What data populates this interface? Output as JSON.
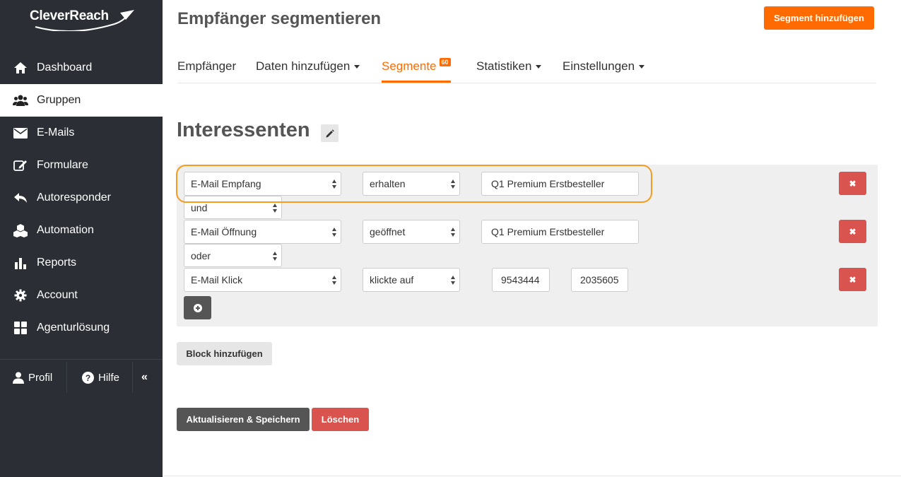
{
  "app": {
    "logo_text": "CleverReach"
  },
  "sidebar": {
    "items": [
      {
        "label": "Dashboard",
        "icon": "home-icon",
        "active": false
      },
      {
        "label": "Gruppen",
        "icon": "users-icon",
        "active": true
      },
      {
        "label": "E-Mails",
        "icon": "envelope-icon",
        "active": false
      },
      {
        "label": "Formulare",
        "icon": "edit-icon",
        "active": false
      },
      {
        "label": "Autoresponder",
        "icon": "reply-icon",
        "active": false
      },
      {
        "label": "Automation",
        "icon": "cubes-icon",
        "active": false
      },
      {
        "label": "Reports",
        "icon": "bar-chart-icon",
        "active": false
      },
      {
        "label": "Account",
        "icon": "gear-icon",
        "active": false
      },
      {
        "label": "Agenturlösung",
        "icon": "grid-icon",
        "active": false
      }
    ],
    "footer": {
      "profile_label": "Profil",
      "help_label": "Hilfe",
      "collapse_icon": "double-chevron-left-icon"
    }
  },
  "header": {
    "title": "Empfänger segmentieren",
    "add_segment_label": "Segment hinzufügen"
  },
  "tabs": [
    {
      "label": "Empfänger",
      "dropdown": false
    },
    {
      "label": "Daten hinzufügen",
      "dropdown": true
    },
    {
      "label": "Segmente",
      "badge": "60",
      "active": true
    },
    {
      "label": "Statistiken",
      "dropdown": true
    },
    {
      "label": "Einstellungen",
      "dropdown": true
    }
  ],
  "segment": {
    "name": "Interessenten",
    "rules": [
      {
        "field": "E-Mail Empfang",
        "operator": "erhalten",
        "value": "Q1 Premium Erstbesteller"
      },
      {
        "field": "E-Mail Öffnung",
        "operator": "geöffnet",
        "value": "Q1 Premium Erstbesteller"
      },
      {
        "field": "E-Mail Klick",
        "operator": "klickte auf",
        "value1": "9543444",
        "value2": "2035605"
      }
    ],
    "connectors": [
      "und",
      "oder"
    ]
  },
  "actions": {
    "add_block_label": "Block hinzufügen",
    "save_label": "Aktualisieren & Speichern",
    "delete_label": "Löschen",
    "remove_symbol": "✖"
  },
  "colors": {
    "accent": "#ff6b00",
    "danger": "#d9534f",
    "sidebar": "#2b2f35",
    "highlight": "#f39c20"
  }
}
